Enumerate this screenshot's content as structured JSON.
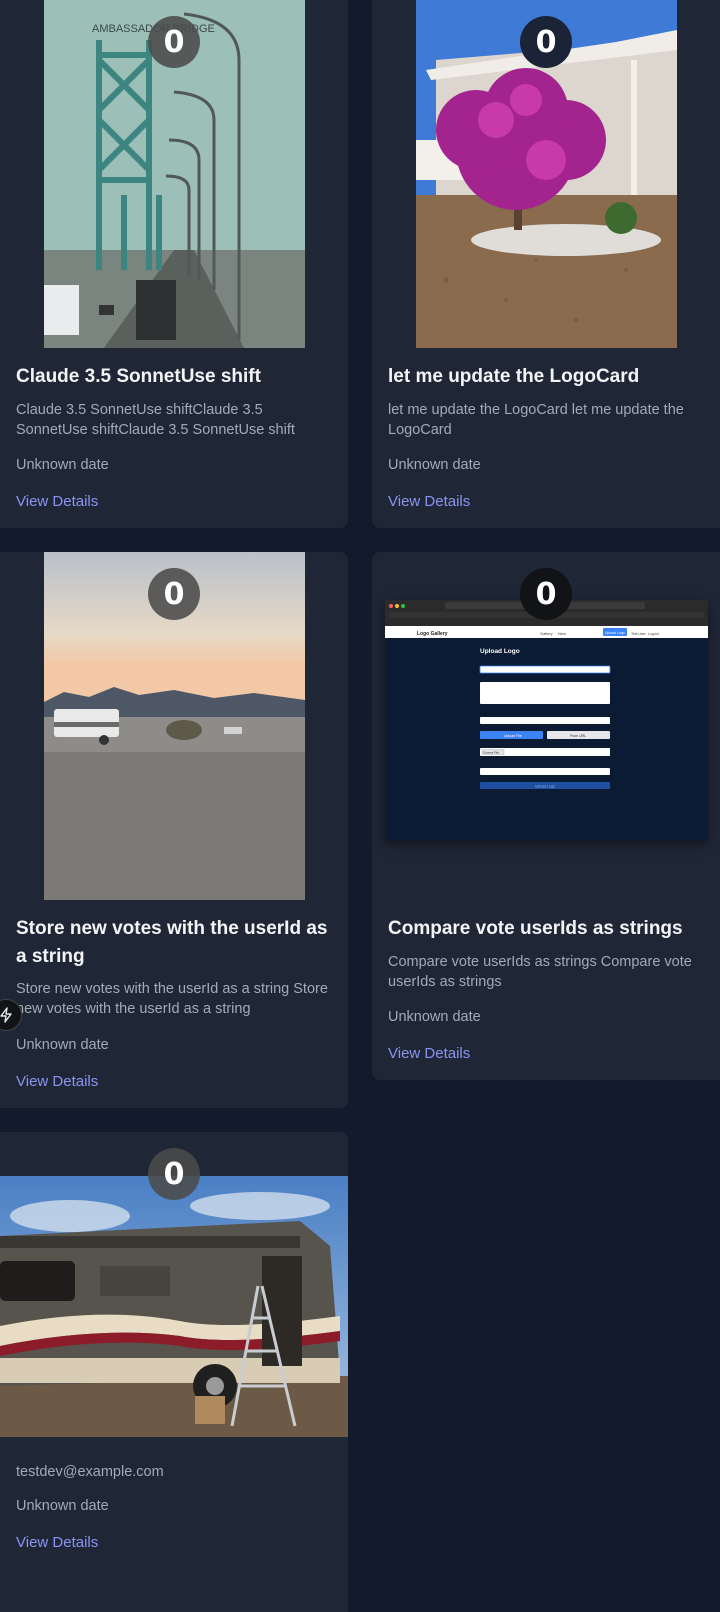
{
  "cards": [
    {
      "votes": "0",
      "image_alt": "Ambassador Bridge",
      "image_sign": "AMBASSADOR BRIDGE",
      "title": "Claude 3.5 SonnetUse shift",
      "description": "Claude 3.5 SonnetUse shiftClaude 3.5 SonnetUse shiftClaude 3.5 SonnetUse shift",
      "date": "Unknown date",
      "link": "View Details"
    },
    {
      "votes": "0",
      "image_alt": "flowering bougainvillea in front of a house",
      "title": "let me update the LogoCard",
      "description": "let me update the LogoCard let me update the LogoCard",
      "date": "Unknown date",
      "link": "View Details"
    },
    {
      "votes": "0",
      "image_alt": "desert campsite at sunset",
      "title": "Store new votes with the userId as a string",
      "description": "Store new votes with the userId as a string Store new votes with the userId as a string",
      "date": "Unknown date",
      "link": "View Details"
    },
    {
      "votes": "0",
      "image_alt": "screenshot of Upload Logo form",
      "screenshot": {
        "app_name": "Logo Gallery",
        "nav": [
          "Gallery",
          "New"
        ],
        "upload_button": "Upload Logo",
        "user": "Test User",
        "logout": "Logout",
        "form_title": "Upload Logo",
        "upload_file": "Upload File",
        "from_url": "From URL",
        "choose_file": "Choose File",
        "submit": "Upload Logo"
      },
      "title": "Compare vote userIds as strings",
      "description": "Compare vote userIds as strings Compare vote userIds as strings",
      "date": "Unknown date",
      "link": "View Details"
    },
    {
      "votes": "0",
      "image_alt": "motorhome with ladder",
      "owner": "testdev@example.com",
      "date": "Unknown date",
      "link": "View Details"
    }
  ],
  "icons": {
    "bolt": "bolt-icon"
  },
  "colors": {
    "background": "#131a2b",
    "card": "#1f2737",
    "link": "#8b94f2"
  }
}
